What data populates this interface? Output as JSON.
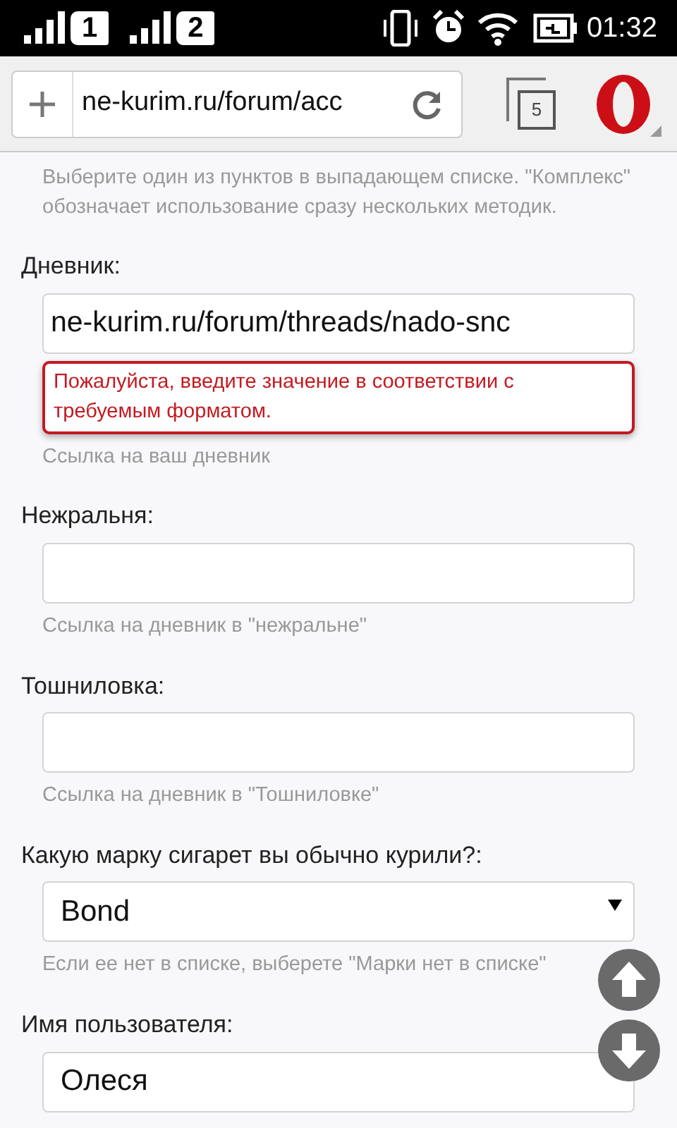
{
  "status_bar": {
    "sims": [
      {
        "label": "1"
      },
      {
        "label": "2"
      }
    ],
    "time": "01:32"
  },
  "browser": {
    "address": "ne-kurim.ru/forum/acc",
    "tab_count": "5"
  },
  "form": {
    "intro_hint": "Выберите один из пунктов в выпадающем списке. \"Комплекс\" обозначает использование сразу нескольких методик.",
    "fields": [
      {
        "kind": "text",
        "label": "Дневник:",
        "value": "ne-kurim.ru/forum/threads/nado-snc",
        "error": "Пожалуйста, введите значение в соответствии с требуемым форматом.",
        "hint": "Ссылка на ваш дневник"
      },
      {
        "kind": "text",
        "label": "Нежральня:",
        "hint": "Ссылка на дневник в \"нежральне\""
      },
      {
        "kind": "text",
        "label": "Тошниловка:",
        "hint": "Ссылка на дневник в \"Тошниловке\""
      },
      {
        "kind": "select",
        "label": "Какую марку сигарет вы обычно курили?:",
        "value": "Bond",
        "hint": "Если ее нет в списке, выберете \"Марки нет в списке\""
      },
      {
        "kind": "text",
        "label": "Имя пользователя:",
        "value": "Олеся"
      }
    ]
  }
}
